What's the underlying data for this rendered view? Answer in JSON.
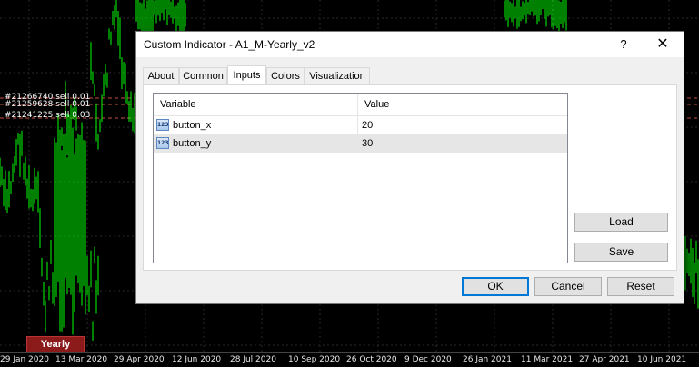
{
  "window": {
    "title": "Custom Indicator - A1_M-Yearly_v2",
    "help_label": "?",
    "close_label": "✕"
  },
  "tabs": [
    {
      "label": "About",
      "active": false
    },
    {
      "label": "Common",
      "active": false
    },
    {
      "label": "Inputs",
      "active": true
    },
    {
      "label": "Colors",
      "active": false
    },
    {
      "label": "Visualization",
      "active": false
    }
  ],
  "inputs_table": {
    "columns": [
      "Variable",
      "Value"
    ],
    "rows": [
      {
        "icon": "numeric-param-icon",
        "icon_text": "123",
        "variable": "button_x",
        "value": "20"
      },
      {
        "icon": "numeric-param-icon",
        "icon_text": "123",
        "variable": "button_y",
        "value": "30"
      }
    ]
  },
  "side_buttons": {
    "load": "Load",
    "save": "Save"
  },
  "footer_buttons": {
    "ok": "OK",
    "cancel": "Cancel",
    "reset": "Reset"
  },
  "chart": {
    "trade_labels": [
      "#21266740 sell 0.01",
      "#21259628 sell 0.01",
      "#21241225 sell 0.03"
    ],
    "date_axis": [
      "29 Jan 2020",
      "13 Mar 2020",
      "29 Apr 2020",
      "12 Jun 2020",
      "28 Jul 2020",
      "10 Sep 2020",
      "26 Oct 2020",
      "9 Dec 2020",
      "26 Jan 2021",
      "11 Mar 2021",
      "27 Apr 2021",
      "10 Jun 2021"
    ],
    "yearly_button": "Yearly",
    "candle_color": "#00ff00",
    "grid_color": "#2a2a2a",
    "trade_line_color": "#c8503c"
  }
}
